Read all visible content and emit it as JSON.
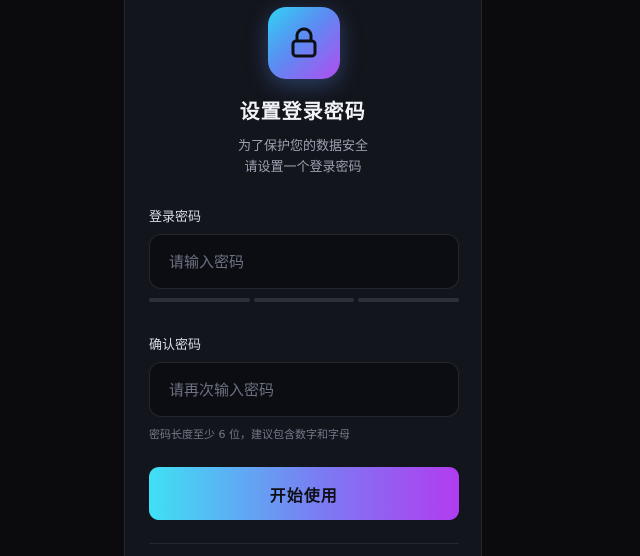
{
  "header": {
    "icon": "lock-icon",
    "title": "设置登录密码",
    "subtitle_line1": "为了保护您的数据安全",
    "subtitle_line2": "请设置一个登录密码"
  },
  "form": {
    "password": {
      "label": "登录密码",
      "value": "",
      "placeholder": "请输入密码"
    },
    "strength_meter": {
      "segments": 3,
      "filled": 0
    },
    "confirm": {
      "label": "确认密码",
      "value": "",
      "placeholder": "请再次输入密码"
    },
    "hint": "密码长度至少 6 位，建议包含数字和字母",
    "submit_label": "开始使用"
  },
  "colors": {
    "background": "#0b0b0e",
    "panel": "#13151c",
    "input_bg": "#0c0d12",
    "accent_start": "#3fe0f5",
    "accent_end": "#b23cf0",
    "meter_empty": "#2d3039"
  }
}
